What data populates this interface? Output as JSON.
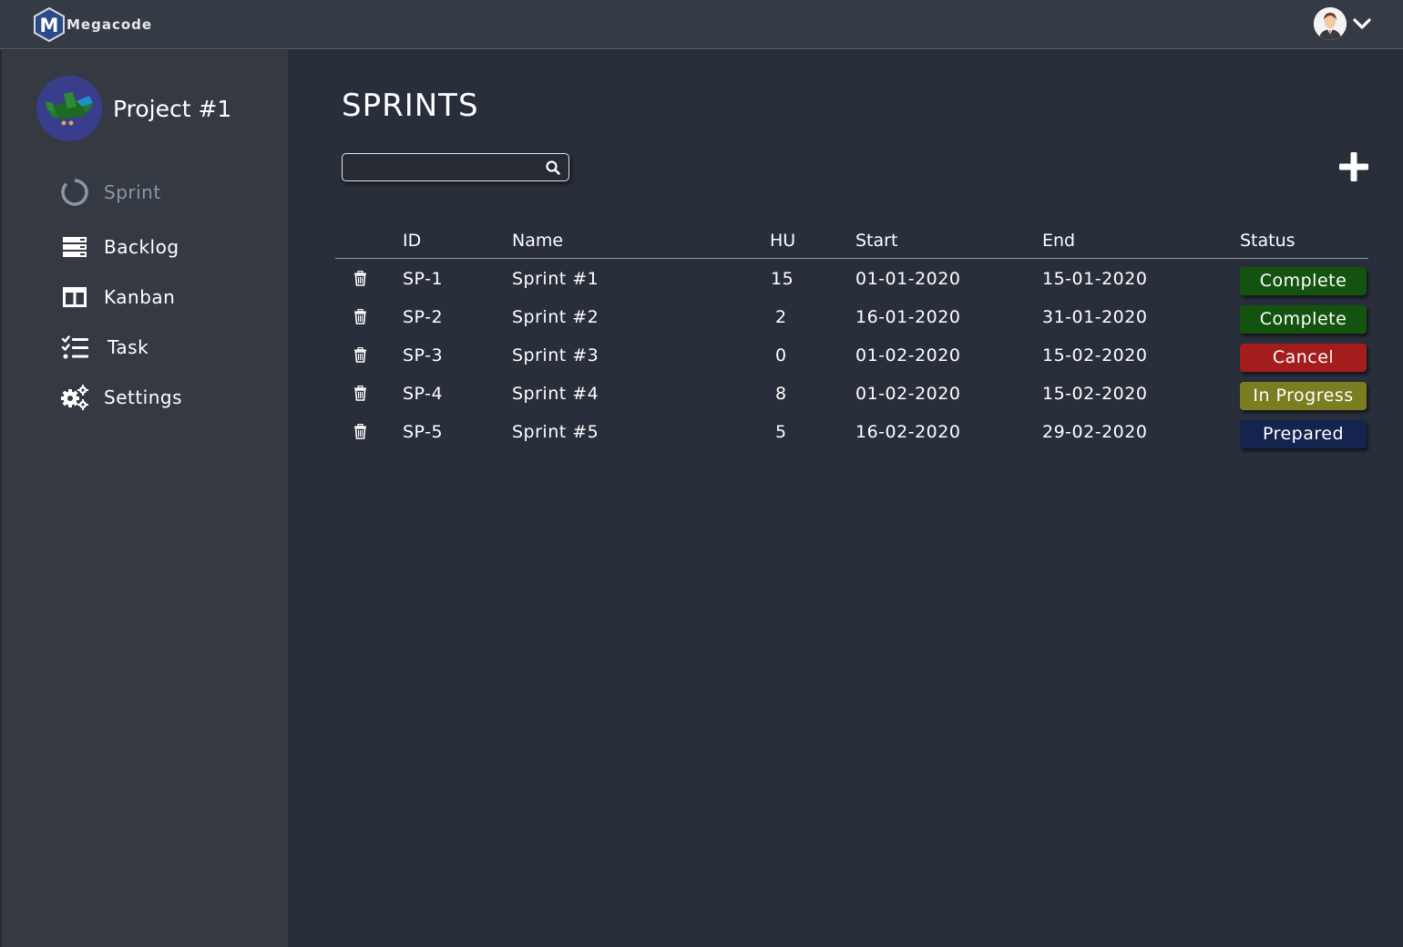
{
  "app": {
    "name": "Megacode",
    "logo_letter": "M"
  },
  "user": {
    "avatar_icon": "user-avatar-icon",
    "menu_icon": "chevron-down-icon"
  },
  "project": {
    "name": "Project #1",
    "avatar_icon": "airplane-icon"
  },
  "sidebar": {
    "items": [
      {
        "label": "Sprint",
        "icon": "circle-loader-icon",
        "active": true
      },
      {
        "label": "Backlog",
        "icon": "backlog-list-icon",
        "active": false
      },
      {
        "label": "Kanban",
        "icon": "kanban-columns-icon",
        "active": false
      },
      {
        "label": "Task",
        "icon": "task-checklist-icon",
        "active": false
      },
      {
        "label": "Settings",
        "icon": "gears-icon",
        "active": false
      }
    ]
  },
  "main": {
    "title": "SPRINTS",
    "search": {
      "value": "",
      "placeholder": "",
      "icon": "search-icon"
    },
    "add_icon": "plus-icon"
  },
  "table": {
    "headers": {
      "id": "ID",
      "name": "Name",
      "hu": "HU",
      "start": "Start",
      "end": "End",
      "status": "Status"
    },
    "rows": [
      {
        "id": "SP-1",
        "name": "Sprint #1",
        "hu": "15",
        "start": "01-01-2020",
        "end": "15-01-2020",
        "status": "Complete",
        "status_color": "#14530f"
      },
      {
        "id": "SP-2",
        "name": "Sprint #2",
        "hu": "2",
        "start": "16-01-2020",
        "end": "31-01-2020",
        "status": "Complete",
        "status_color": "#14530f"
      },
      {
        "id": "SP-3",
        "name": "Sprint #3",
        "hu": "0",
        "start": "01-02-2020",
        "end": "15-02-2020",
        "status": "Cancel",
        "status_color": "#a31d1d"
      },
      {
        "id": "SP-4",
        "name": "Sprint #4",
        "hu": "8",
        "start": "01-02-2020",
        "end": "15-02-2020",
        "status": "In Progress",
        "status_color": "#7a7d20"
      },
      {
        "id": "SP-5",
        "name": "Sprint #5",
        "hu": "5",
        "start": "16-02-2020",
        "end": "29-02-2020",
        "status": "Prepared",
        "status_color": "#14244e"
      }
    ]
  },
  "colors": {
    "background": "#282e3a",
    "topbar": "#353b45",
    "sidebar": "#353a42",
    "active_nav": "#8b96a8"
  }
}
